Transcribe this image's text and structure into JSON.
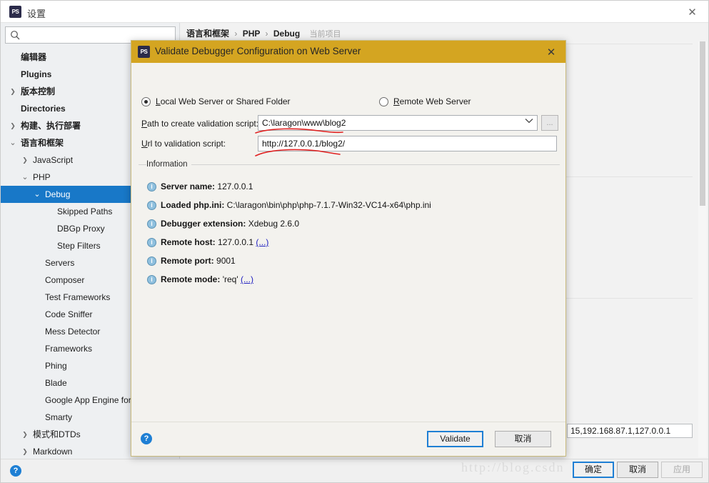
{
  "window": {
    "title": "设置",
    "icon": "PS",
    "close_icon": "✕"
  },
  "search": {
    "placeholder": "",
    "value": "",
    "icon": "search-icon"
  },
  "sidebar": {
    "items": [
      {
        "label": "编辑器",
        "indent": 0,
        "arrow": "",
        "bold": true,
        "selected": false
      },
      {
        "label": "Plugins",
        "indent": 0,
        "arrow": "",
        "bold": true,
        "selected": false
      },
      {
        "label": "版本控制",
        "indent": 0,
        "arrow": "›",
        "bold": true,
        "selected": false
      },
      {
        "label": "Directories",
        "indent": 0,
        "arrow": "",
        "bold": true,
        "selected": false
      },
      {
        "label": "构建、执行部署",
        "indent": 0,
        "arrow": "›",
        "bold": true,
        "selected": false
      },
      {
        "label": "语言和框架",
        "indent": 0,
        "arrow": "⌄",
        "bold": true,
        "selected": false
      },
      {
        "label": "JavaScript",
        "indent": 1,
        "arrow": "›",
        "bold": false,
        "selected": false
      },
      {
        "label": "PHP",
        "indent": 1,
        "arrow": "⌄",
        "bold": false,
        "selected": false
      },
      {
        "label": "Debug",
        "indent": 2,
        "arrow": "⌄",
        "bold": false,
        "selected": true
      },
      {
        "label": "Skipped Paths",
        "indent": 3,
        "arrow": "",
        "bold": false,
        "selected": false
      },
      {
        "label": "DBGp Proxy",
        "indent": 3,
        "arrow": "",
        "bold": false,
        "selected": false
      },
      {
        "label": "Step Filters",
        "indent": 3,
        "arrow": "",
        "bold": false,
        "selected": false
      },
      {
        "label": "Servers",
        "indent": 2,
        "arrow": "",
        "bold": false,
        "selected": false
      },
      {
        "label": "Composer",
        "indent": 2,
        "arrow": "",
        "bold": false,
        "selected": false
      },
      {
        "label": "Test Frameworks",
        "indent": 2,
        "arrow": "",
        "bold": false,
        "selected": false
      },
      {
        "label": "Code Sniffer",
        "indent": 2,
        "arrow": "",
        "bold": false,
        "selected": false
      },
      {
        "label": "Mess Detector",
        "indent": 2,
        "arrow": "",
        "bold": false,
        "selected": false
      },
      {
        "label": "Frameworks",
        "indent": 2,
        "arrow": "",
        "bold": false,
        "selected": false
      },
      {
        "label": "Phing",
        "indent": 2,
        "arrow": "",
        "bold": false,
        "selected": false
      },
      {
        "label": "Blade",
        "indent": 2,
        "arrow": "",
        "bold": false,
        "selected": false
      },
      {
        "label": "Google App Engine for PH",
        "indent": 2,
        "arrow": "",
        "bold": false,
        "selected": false
      },
      {
        "label": "Smarty",
        "indent": 2,
        "arrow": "",
        "bold": false,
        "selected": false
      },
      {
        "label": "模式和DTDs",
        "indent": 1,
        "arrow": "›",
        "bold": false,
        "selected": false
      },
      {
        "label": "Markdown",
        "indent": 1,
        "arrow": "›",
        "bold": false,
        "selected": false
      }
    ]
  },
  "breadcrumb": {
    "part1": "语言和框架",
    "sep": "›",
    "part2": "PHP",
    "part3": "Debug",
    "badge": "当前项目"
  },
  "right_panel": {
    "hidden_field_value": "15,192.168.87.1,127.0.0.1"
  },
  "bottom": {
    "help_icon": "?",
    "ok_label": "确定",
    "cancel_label": "取消",
    "apply_label": "应用",
    "watermark": "http://blog.csdn"
  },
  "dialog": {
    "icon": "PS",
    "title": "Validate Debugger Configuration on Web Server",
    "close_icon": "✕",
    "radios": [
      {
        "label_underlined": "L",
        "label_rest": "ocal Web Server or Shared Folder",
        "selected": true
      },
      {
        "label_underlined": "R",
        "label_rest": "emote Web Server",
        "selected": false
      }
    ],
    "fields": [
      {
        "label_underlined": "P",
        "label_rest": "ath to create validation script:",
        "value": "C:\\laragon\\www\\blog2",
        "has_combo": true,
        "has_browse": true,
        "browse_label": "..."
      },
      {
        "label_underlined": "U",
        "label_rest": "rl to validation script:",
        "value": "http://127.0.0.1/blog2/",
        "has_combo": false,
        "has_browse": false,
        "browse_label": ""
      }
    ],
    "group_label": "Information",
    "info": [
      {
        "key": "Server name:",
        "value": "127.0.0.1",
        "link": ""
      },
      {
        "key": "Loaded php.ini:",
        "value": "C:\\laragon\\bin\\php\\php-7.1.7-Win32-VC14-x64\\php.ini",
        "link": ""
      },
      {
        "key": "Debugger extension:",
        "value": "Xdebug 2.6.0",
        "link": ""
      },
      {
        "key": "Remote host:",
        "value": "127.0.0.1",
        "link": "(...)"
      },
      {
        "key": "Remote port:",
        "value": "9001",
        "link": ""
      },
      {
        "key": "Remote mode:",
        "value": "'req'",
        "link": "(...)"
      }
    ],
    "footer": {
      "help_icon": "?",
      "validate_label": "Validate",
      "cancel_label": "取消"
    }
  }
}
